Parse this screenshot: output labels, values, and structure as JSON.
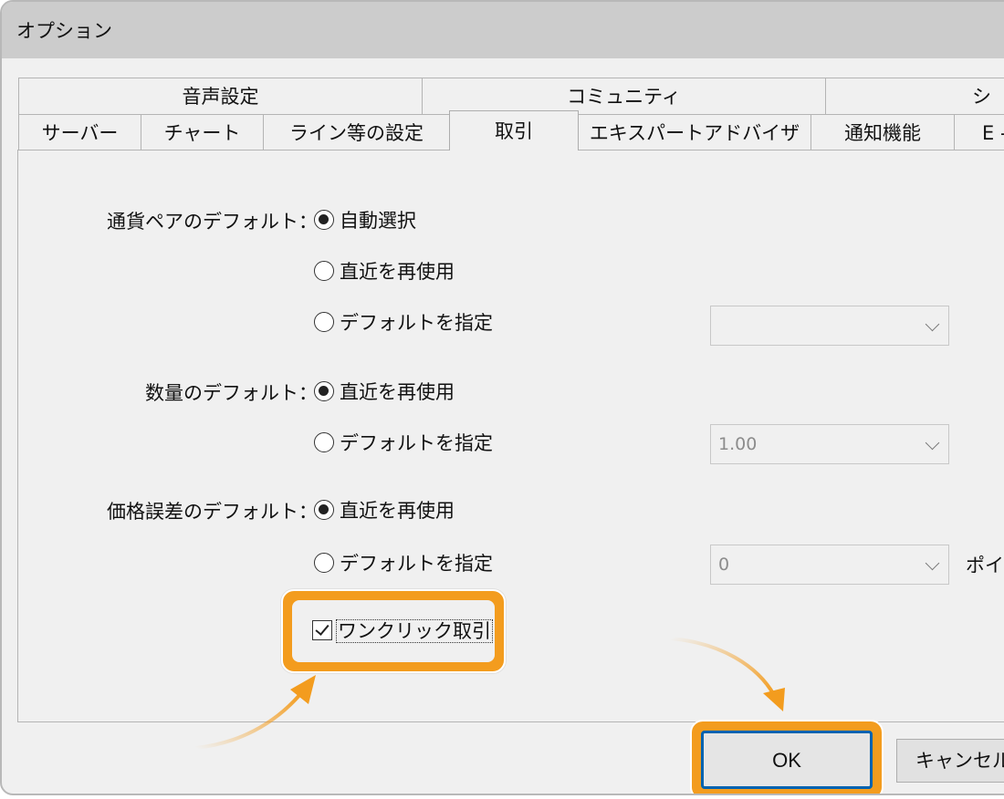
{
  "window": {
    "title": "オプション"
  },
  "tabs": {
    "row1": [
      "音声設定",
      "コミュニティ",
      "シ"
    ],
    "row2": [
      "サーバー",
      "チャート",
      "ライン等の設定",
      "取引",
      "エキスパートアドバイザ",
      "通知機能",
      "E -"
    ],
    "active": "取引"
  },
  "trade": {
    "symbol_default": {
      "label": "通貨ペアのデフォルト：",
      "options": [
        "自動選択",
        "直近を再使用",
        "デフォルトを指定"
      ],
      "selected": "自動選択",
      "combo_value": ""
    },
    "volume_default": {
      "label": "数量のデフォルト：",
      "options": [
        "直近を再使用",
        "デフォルトを指定"
      ],
      "selected": "直近を再使用",
      "combo_value": "1.00"
    },
    "deviation_default": {
      "label": "価格誤差のデフォルト：",
      "options": [
        "直近を再使用",
        "デフォルトを指定"
      ],
      "selected": "直近を再使用",
      "combo_value": "0",
      "unit": "ポイン"
    },
    "one_click": {
      "label": "ワンクリック取引",
      "checked": true
    }
  },
  "buttons": {
    "ok": "OK",
    "cancel": "キャンセル"
  },
  "colors": {
    "highlight": "#f39c1e",
    "focus": "#0063b1"
  }
}
